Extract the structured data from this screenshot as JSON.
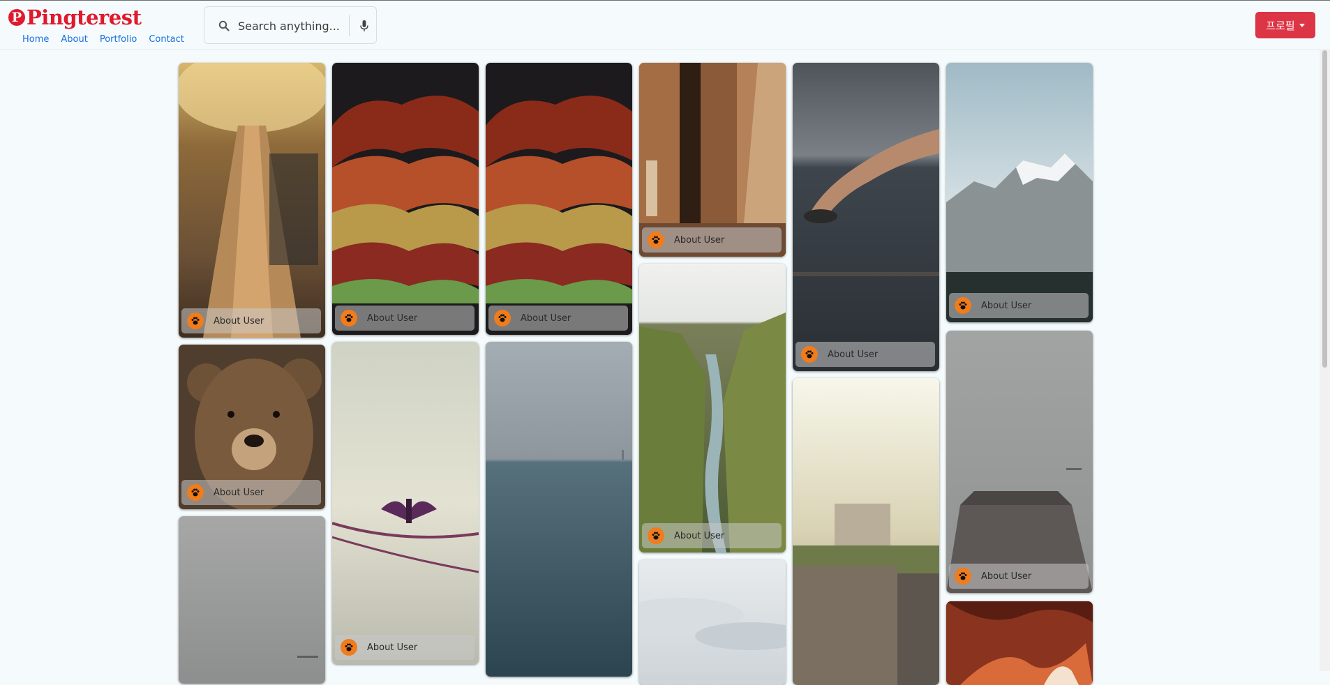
{
  "header": {
    "logo_letter": "P",
    "logo_text": "Pingterest",
    "nav": [
      "Home",
      "About",
      "Portfolio",
      "Contact"
    ],
    "search_placeholder": "Search anything...",
    "profile_label": "프로필"
  },
  "colors": {
    "brand": "#e0192d",
    "nav_link": "#1a6fe0",
    "profile_button": "#dc3545",
    "avatar": "#f07c1c"
  },
  "icons": {
    "search": "search-icon",
    "mic": "microphone-icon",
    "avatar": "paw-icon",
    "dropdown": "caret-down-icon"
  },
  "pins": [
    {
      "label": "About User",
      "subject": "escalator-tunnel"
    },
    {
      "label": "About User",
      "subject": "bear"
    },
    {
      "label": "",
      "subject": "fog"
    },
    {
      "label": "About User",
      "subject": "autumn-leaves"
    },
    {
      "label": "About User",
      "subject": "bird-on-rope"
    },
    {
      "label": "About User",
      "subject": "autumn-leaves"
    },
    {
      "label": "",
      "subject": "sea"
    },
    {
      "label": "About User",
      "subject": "sunlit-room"
    },
    {
      "label": "About User",
      "subject": "canyon"
    },
    {
      "label": "",
      "subject": "cloudy-sky"
    },
    {
      "label": "About User",
      "subject": "swimmer"
    },
    {
      "label": "",
      "subject": "city"
    },
    {
      "label": "About User",
      "subject": "mountain"
    },
    {
      "label": "About User",
      "subject": "foggy-pier"
    },
    {
      "label": "",
      "subject": "red-canyon"
    }
  ]
}
